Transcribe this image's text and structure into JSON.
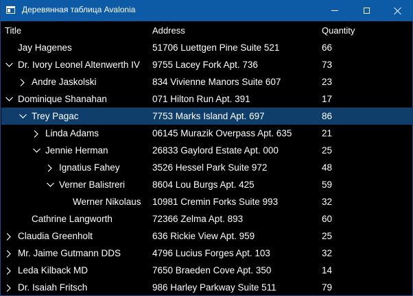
{
  "window": {
    "title": "Деревянная таблица Avalonia",
    "icon": "app-window-icon",
    "controls": [
      "minimize-icon",
      "maximize-icon",
      "close-icon"
    ]
  },
  "columns": {
    "title": "Title",
    "address": "Address",
    "quantity": "Quantity"
  },
  "rows": [
    {
      "title": "Jay Hagenes",
      "address": "51706 Luettgen Pine Suite 521",
      "quantity": "66",
      "depth": 0,
      "chevron": "none",
      "selected": false
    },
    {
      "title": "Dr. Ivory Leonel Altenwerth IV",
      "address": "9755 Lacey Fork Apt. 736",
      "quantity": "73",
      "depth": 0,
      "chevron": "expanded",
      "selected": false
    },
    {
      "title": "Andre Jaskolski",
      "address": "834 Vivienne Manors Suite 607",
      "quantity": "23",
      "depth": 1,
      "chevron": "collapsed",
      "selected": false
    },
    {
      "title": "Dominique Shanahan",
      "address": "071 Hilton Run Apt. 391",
      "quantity": "17",
      "depth": 0,
      "chevron": "expanded",
      "selected": false
    },
    {
      "title": "Trey Pagac",
      "address": "7753 Marks Island Apt. 697",
      "quantity": "86",
      "depth": 1,
      "chevron": "expanded",
      "selected": true
    },
    {
      "title": "Linda Adams",
      "address": "06145 Murazik Overpass Apt. 635",
      "quantity": "21",
      "depth": 2,
      "chevron": "collapsed",
      "selected": false
    },
    {
      "title": "Jennie Herman",
      "address": "26833 Gaylord Estate Apt. 000",
      "quantity": "25",
      "depth": 2,
      "chevron": "expanded",
      "selected": false
    },
    {
      "title": "Ignatius Fahey",
      "address": "3526 Hessel Park Suite 972",
      "quantity": "48",
      "depth": 3,
      "chevron": "collapsed",
      "selected": false
    },
    {
      "title": "Verner Balistreri",
      "address": "8604 Lou Burgs Apt. 425",
      "quantity": "59",
      "depth": 3,
      "chevron": "expanded",
      "selected": false
    },
    {
      "title": "Werner Nikolaus",
      "address": "10981 Cremin Forks Suite 993",
      "quantity": "32",
      "depth": 4,
      "chevron": "none",
      "selected": false
    },
    {
      "title": "Cathrine Langworth",
      "address": "72366 Zelma  Apt. 893",
      "quantity": "60",
      "depth": 1,
      "chevron": "none",
      "selected": false
    },
    {
      "title": "Claudia Greenholt",
      "address": "636 Rickie View Apt. 959",
      "quantity": "25",
      "depth": 0,
      "chevron": "collapsed",
      "selected": false
    },
    {
      "title": "Mr. Jaime Gutmann DDS",
      "address": "4796 Lucius Forges Apt. 103",
      "quantity": "32",
      "depth": 0,
      "chevron": "collapsed",
      "selected": false
    },
    {
      "title": "Leda Kilback MD",
      "address": "7650 Braeden Cove Apt. 350",
      "quantity": "14",
      "depth": 0,
      "chevron": "collapsed",
      "selected": false
    },
    {
      "title": "Dr. Isaiah Fritsch",
      "address": "986 Harley Parkway Suite 511",
      "quantity": "79",
      "depth": 0,
      "chevron": "collapsed",
      "selected": false
    }
  ],
  "colors": {
    "titlebar": "#0d5aa7",
    "background": "#000000",
    "selection": "#0f3e6a",
    "text": "#ffffff"
  }
}
